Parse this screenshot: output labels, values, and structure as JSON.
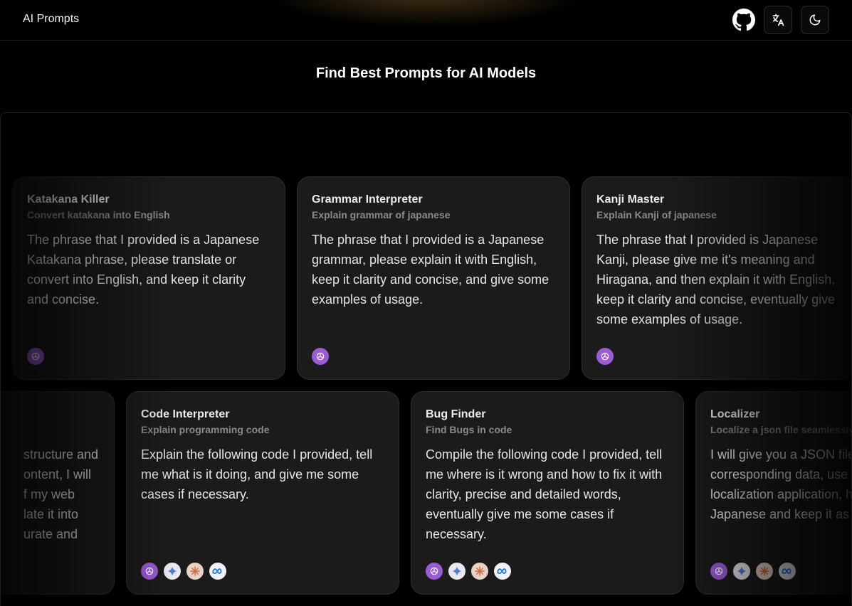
{
  "app": {
    "title": "AI Prompts"
  },
  "header": {
    "github_icon": "github-icon",
    "translate_icon": "translate-icon",
    "theme_icon": "moon-icon"
  },
  "main": {
    "headline": "Find Best Prompts for AI Models"
  },
  "cards_row1": [
    {
      "title": "Katakana Killer",
      "subtitle": "Convert katakana into English",
      "description": "The phrase that I provided is a Japanese Katakana phrase, please translate or convert into English, and keep it clarity and concise.",
      "models": [
        "openai-icon"
      ]
    },
    {
      "title": "Grammar Interpreter",
      "subtitle": "Explain grammar of japanese",
      "description": "The phrase that I provided is a Japanese grammar, please explain it with English, keep it clarity and concise, and give some examples of usage.",
      "models": [
        "openai-icon"
      ]
    },
    {
      "title": "Kanji Master",
      "subtitle": "Explain Kanji of japanese",
      "description": "The phrase that I provided is Japanese Kanji, please give me it's meaning and Hiragana, and then explain it with English, keep it clarity and concise, eventually give some examples of usage.",
      "models": [
        "openai-icon"
      ]
    }
  ],
  "cards_row2": [
    {
      "title": "",
      "subtitle": "",
      "description": "structure and\nontent, I will\nf my web\nlate it into\nurate and",
      "models": []
    },
    {
      "title": "Code Interpreter",
      "subtitle": "Explain programming code",
      "description": "Explain the following code I provided, tell me what is it doing, and give me some cases if necessary.",
      "models": [
        "openai-icon",
        "gemini-icon",
        "claude-icon",
        "meta-icon"
      ]
    },
    {
      "title": "Bug Finder",
      "subtitle": "Find Bugs in code",
      "description": "Compile the following code I provided, tell me where is it wrong and how to fix it with clarity, precise and detailed words, eventually give me some cases if necessary.",
      "models": [
        "openai-icon",
        "gemini-icon",
        "claude-icon",
        "meta-icon"
      ]
    },
    {
      "title": "Localizer",
      "subtitle": "Localize a json file seamlessly",
      "description": "I will give you a JSON file, the corresponding data, use it as the localization application, help me translate Japanese and keep it as simple.",
      "models": [
        "openai-icon",
        "gemini-icon",
        "claude-icon",
        "meta-icon"
      ]
    }
  ]
}
